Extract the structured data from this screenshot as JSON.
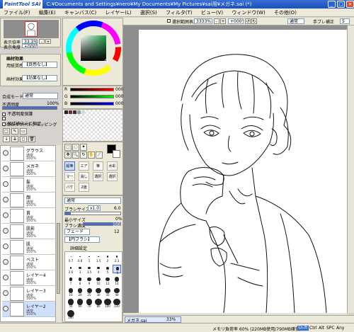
{
  "title": {
    "logo": "PaintTool SAI",
    "path": "C:¥Documents and Settings¥nero¥My Documents¥My Pictures¥sai用¥メガネ.sai (*)"
  },
  "menu": [
    "ファイル(F)",
    "編集(E)",
    "キャンバス(C)",
    "レイヤー(L)",
    "選択(S)",
    "フィルタ(T)",
    "ビュー(V)",
    "ウィンドウ(W)",
    "その他(O)"
  ],
  "navigator": {
    "zoom_label": "表示倍率",
    "zoom": "33.3%",
    "angle_label": "表示角度",
    "angle": "+000°"
  },
  "paper_effect": {
    "header": "画材効果",
    "texture_label": "用紙質感",
    "texture_value": "【質感なし】",
    "effect_label": "画材効果",
    "effect_value": "【効果なし】"
  },
  "blend": {
    "mode_label": "合成モード",
    "mode_value": "通常",
    "opacity_label": "不透明度",
    "opacity_value": "100%"
  },
  "layer_options": [
    "不透明度保護",
    "下のレイヤーでクリッピング",
    "領域検出元に指定"
  ],
  "layers": [
    {
      "name": "グラウス",
      "mode": "通常",
      "opacity": "100%"
    },
    {
      "name": "メガネ",
      "mode": "通常",
      "opacity": "100%"
    },
    {
      "name": "髪",
      "mode": "通常",
      "opacity": "100%"
    },
    {
      "name": "顔",
      "mode": "通常",
      "opacity": "100%"
    },
    {
      "name": "首",
      "mode": "通常",
      "opacity": "100%"
    },
    {
      "name": "肌影",
      "mode": "通常",
      "opacity": "100%"
    },
    {
      "name": "肌",
      "mode": "通常",
      "opacity": "100%"
    },
    {
      "name": "ベスト",
      "mode": "通常",
      "opacity": "100%"
    },
    {
      "name": "レイヤー4",
      "mode": "通常",
      "opacity": "100%"
    },
    {
      "name": "レイヤー3",
      "mode": "通常",
      "opacity": "100%"
    },
    {
      "name": "レイヤー2",
      "mode": "通常",
      "opacity": "100%",
      "selected": true
    }
  ],
  "color": {
    "rgb_labels": [
      "R",
      "G",
      "B"
    ],
    "rgb_values": [
      "000",
      "000",
      "000"
    ],
    "primary": "#000000",
    "secondary": "#ffffff"
  },
  "toolbar": {
    "antialias_label": "選択範囲表示",
    "zoom": "3333%",
    "angle": "+000°",
    "mode": "通常",
    "correction_label": "手ブレ補正",
    "correction_value": "5"
  },
  "tools": [
    "鉛筆",
    "エアブラシ",
    "筆",
    "水彩筆",
    "マーカー",
    "消しゴム",
    "選択ペン",
    "選択消し",
    "バケツ",
    "2値ペン"
  ],
  "brush": {
    "mode_value": "通常",
    "size_label": "ブラシサイズ",
    "size_mult": "x1.0",
    "size_value": "6.0",
    "min_label": "最小サイズ",
    "min_value": "0%",
    "density_label": "ブラシ濃度",
    "density_value": "100",
    "edge_label": "フェード",
    "edge_value": "12",
    "shape_value": "【円ブラシ】",
    "detail_label": "詳細設定",
    "sizes": [
      "0.7",
      "0.8",
      "1",
      "1.5",
      "2",
      "2.3",
      "2.6",
      "3",
      "3.5",
      "4",
      "5",
      "6",
      "7",
      "8",
      "9",
      "10",
      "12",
      "14",
      "16",
      "20",
      "25",
      "30",
      "35",
      "40",
      "50",
      "60",
      "70",
      "80",
      "100",
      "120",
      "160"
    ]
  },
  "tab": {
    "name": "メガネ.sai",
    "zoom": "33%"
  },
  "status": {
    "memory": "メモリ負荷率 60% (220MB使用/790MB確保)",
    "keys": [
      "Shift",
      "Ctrl",
      "Alt",
      "SPC",
      "Any"
    ]
  }
}
